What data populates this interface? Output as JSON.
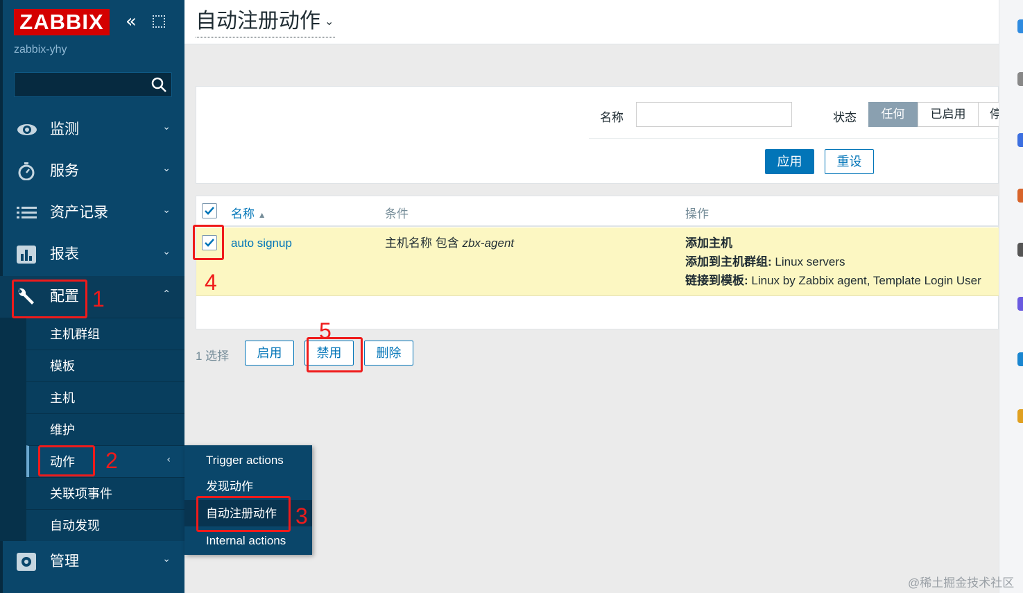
{
  "sidebar": {
    "logo": "ZABBIX",
    "server_name": "zabbix-yhy",
    "menu": [
      {
        "label": "监测",
        "icon": "eye-icon"
      },
      {
        "label": "服务",
        "icon": "stopwatch-icon"
      },
      {
        "label": "资产记录",
        "icon": "list-icon"
      },
      {
        "label": "报表",
        "icon": "bar-chart-icon"
      },
      {
        "label": "配置",
        "icon": "wrench-icon"
      },
      {
        "label": "管理",
        "icon": "gear-icon"
      }
    ],
    "config_submenu": [
      "主机群组",
      "模板",
      "主机",
      "维护",
      "动作",
      "关联项事件",
      "自动发现"
    ],
    "actions_flyout": [
      "Trigger actions",
      "发现动作",
      "自动注册动作",
      "Internal actions"
    ]
  },
  "header": {
    "title": "自动注册动作"
  },
  "filter": {
    "name_label": "名称",
    "name_value": "",
    "status_label": "状态",
    "status_options": [
      "任何",
      "已启用",
      "停"
    ],
    "status_selected": "任何",
    "apply_label": "应用",
    "reset_label": "重设"
  },
  "table": {
    "columns": {
      "name": "名称",
      "sort_indicator": "▲",
      "conditions": "条件",
      "operations": "操作"
    },
    "rows": [
      {
        "name": "auto signup",
        "condition_text": "主机名称 包含",
        "condition_value": "zbx-agent",
        "op1": "添加主机",
        "op2_label": "添加到主机群组:",
        "op2_value": " Linux servers",
        "op3_label": "链接到模板:",
        "op3_value": " Linux by Zabbix agent, Template Login User"
      }
    ]
  },
  "bulk": {
    "selected_count": "1 选择",
    "enable_label": "启用",
    "disable_label": "禁用",
    "delete_label": "删除"
  },
  "annotations": [
    "1",
    "2",
    "3",
    "4",
    "5"
  ],
  "watermark": "@稀土掘金技术社区",
  "colors": {
    "sidebar": "#0a466a",
    "logo": "#d40000",
    "accent": "#0275b8",
    "annotation": "#ef1b1b",
    "row_highlight": "#fcf7c2"
  }
}
